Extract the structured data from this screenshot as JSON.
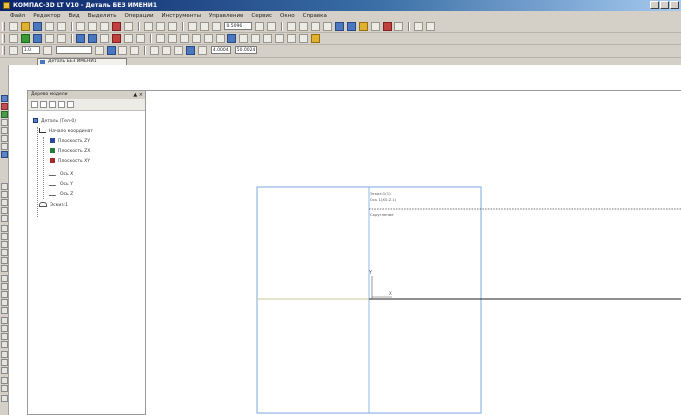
{
  "window": {
    "title": "КОМПАС-3D LT V10 - Деталь БЕЗ ИМЕНИ1"
  },
  "menu": {
    "items": [
      "Файл",
      "Редактор",
      "Вид",
      "Выделить",
      "Операции",
      "Инструменты",
      "Управление",
      "Сервис",
      "Окно",
      "Справка"
    ]
  },
  "toolbar": {
    "zoom_value": "0.5096",
    "filter_value": "1.0",
    "coord_x": "4.0004",
    "coord_y": "50.0024"
  },
  "document_tab": {
    "label": "Деталь БЕЗ ИМЕНИ1"
  },
  "tree_panel": {
    "header": "Дерево модели",
    "close_glyph": "▲ ×",
    "nodes": [
      {
        "label": "Деталь (Тел-0)",
        "icon": "part-icon"
      },
      {
        "label": "Начало координат",
        "icon": "origin-icon"
      },
      {
        "label": "Плоскость ZY",
        "icon": "plane-blue-icon"
      },
      {
        "label": "Плоскость ZX",
        "icon": "plane-green-icon"
      },
      {
        "label": "Плоскость XY",
        "icon": "plane-red-icon"
      },
      {
        "label": "Ось X",
        "icon": "axis-icon"
      },
      {
        "label": "Ось Y",
        "icon": "axis-icon"
      },
      {
        "label": "Ось Z",
        "icon": "axis-icon"
      },
      {
        "label": "Эскиз:1",
        "icon": "sketch-icon"
      }
    ]
  },
  "workspace": {
    "sheet_label_1": "Эскиз:1(1)",
    "sheet_label_2": "Ось 1(X0.Z.1)",
    "sheet_label_3": "Скругление",
    "axis_y_label": "Y",
    "axis_x_label": "X"
  },
  "colors": {
    "titlebar": "#0a246a",
    "ui_face": "#d4d0c8",
    "sheet_frame": "#7aa8d8",
    "horizontal_axis": "#c8c890"
  }
}
